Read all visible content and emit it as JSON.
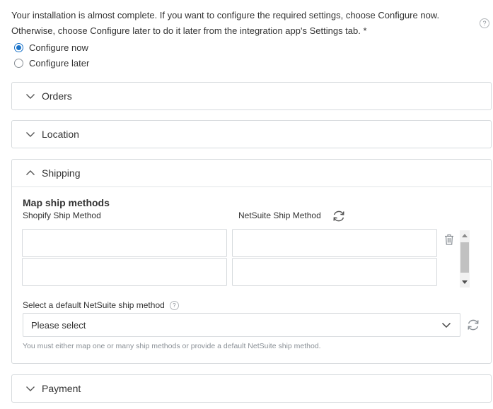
{
  "intro": {
    "text": "Your installation is almost complete. If you want to configure the required settings, choose Configure now. Otherwise, choose Configure later to do it later from the integration app's Settings tab. *",
    "help_glyph": "?"
  },
  "options": {
    "configure_now": "Configure now",
    "configure_later": "Configure later",
    "selected": "configure_now"
  },
  "sections": {
    "orders": "Orders",
    "location": "Location",
    "shipping": "Shipping",
    "payment": "Payment"
  },
  "shipping": {
    "map_title": "Map ship methods",
    "shopify_col": "Shopify Ship Method",
    "netsuite_col": "NetSuite Ship Method",
    "default_label": "Select a default NetSuite ship method",
    "default_help_glyph": "?",
    "default_value": "Please select",
    "hint": "You must either map one or many ship methods or provide a default NetSuite ship method."
  },
  "icons": {
    "collapsed": "chevron-down-icon",
    "expanded": "chevron-up-icon",
    "refresh": "refresh-icon",
    "delete": "trash-icon",
    "help": "help-icon"
  },
  "colors": {
    "accent": "#1a73c9",
    "border": "#d6dadd",
    "hint": "#8a9096"
  }
}
